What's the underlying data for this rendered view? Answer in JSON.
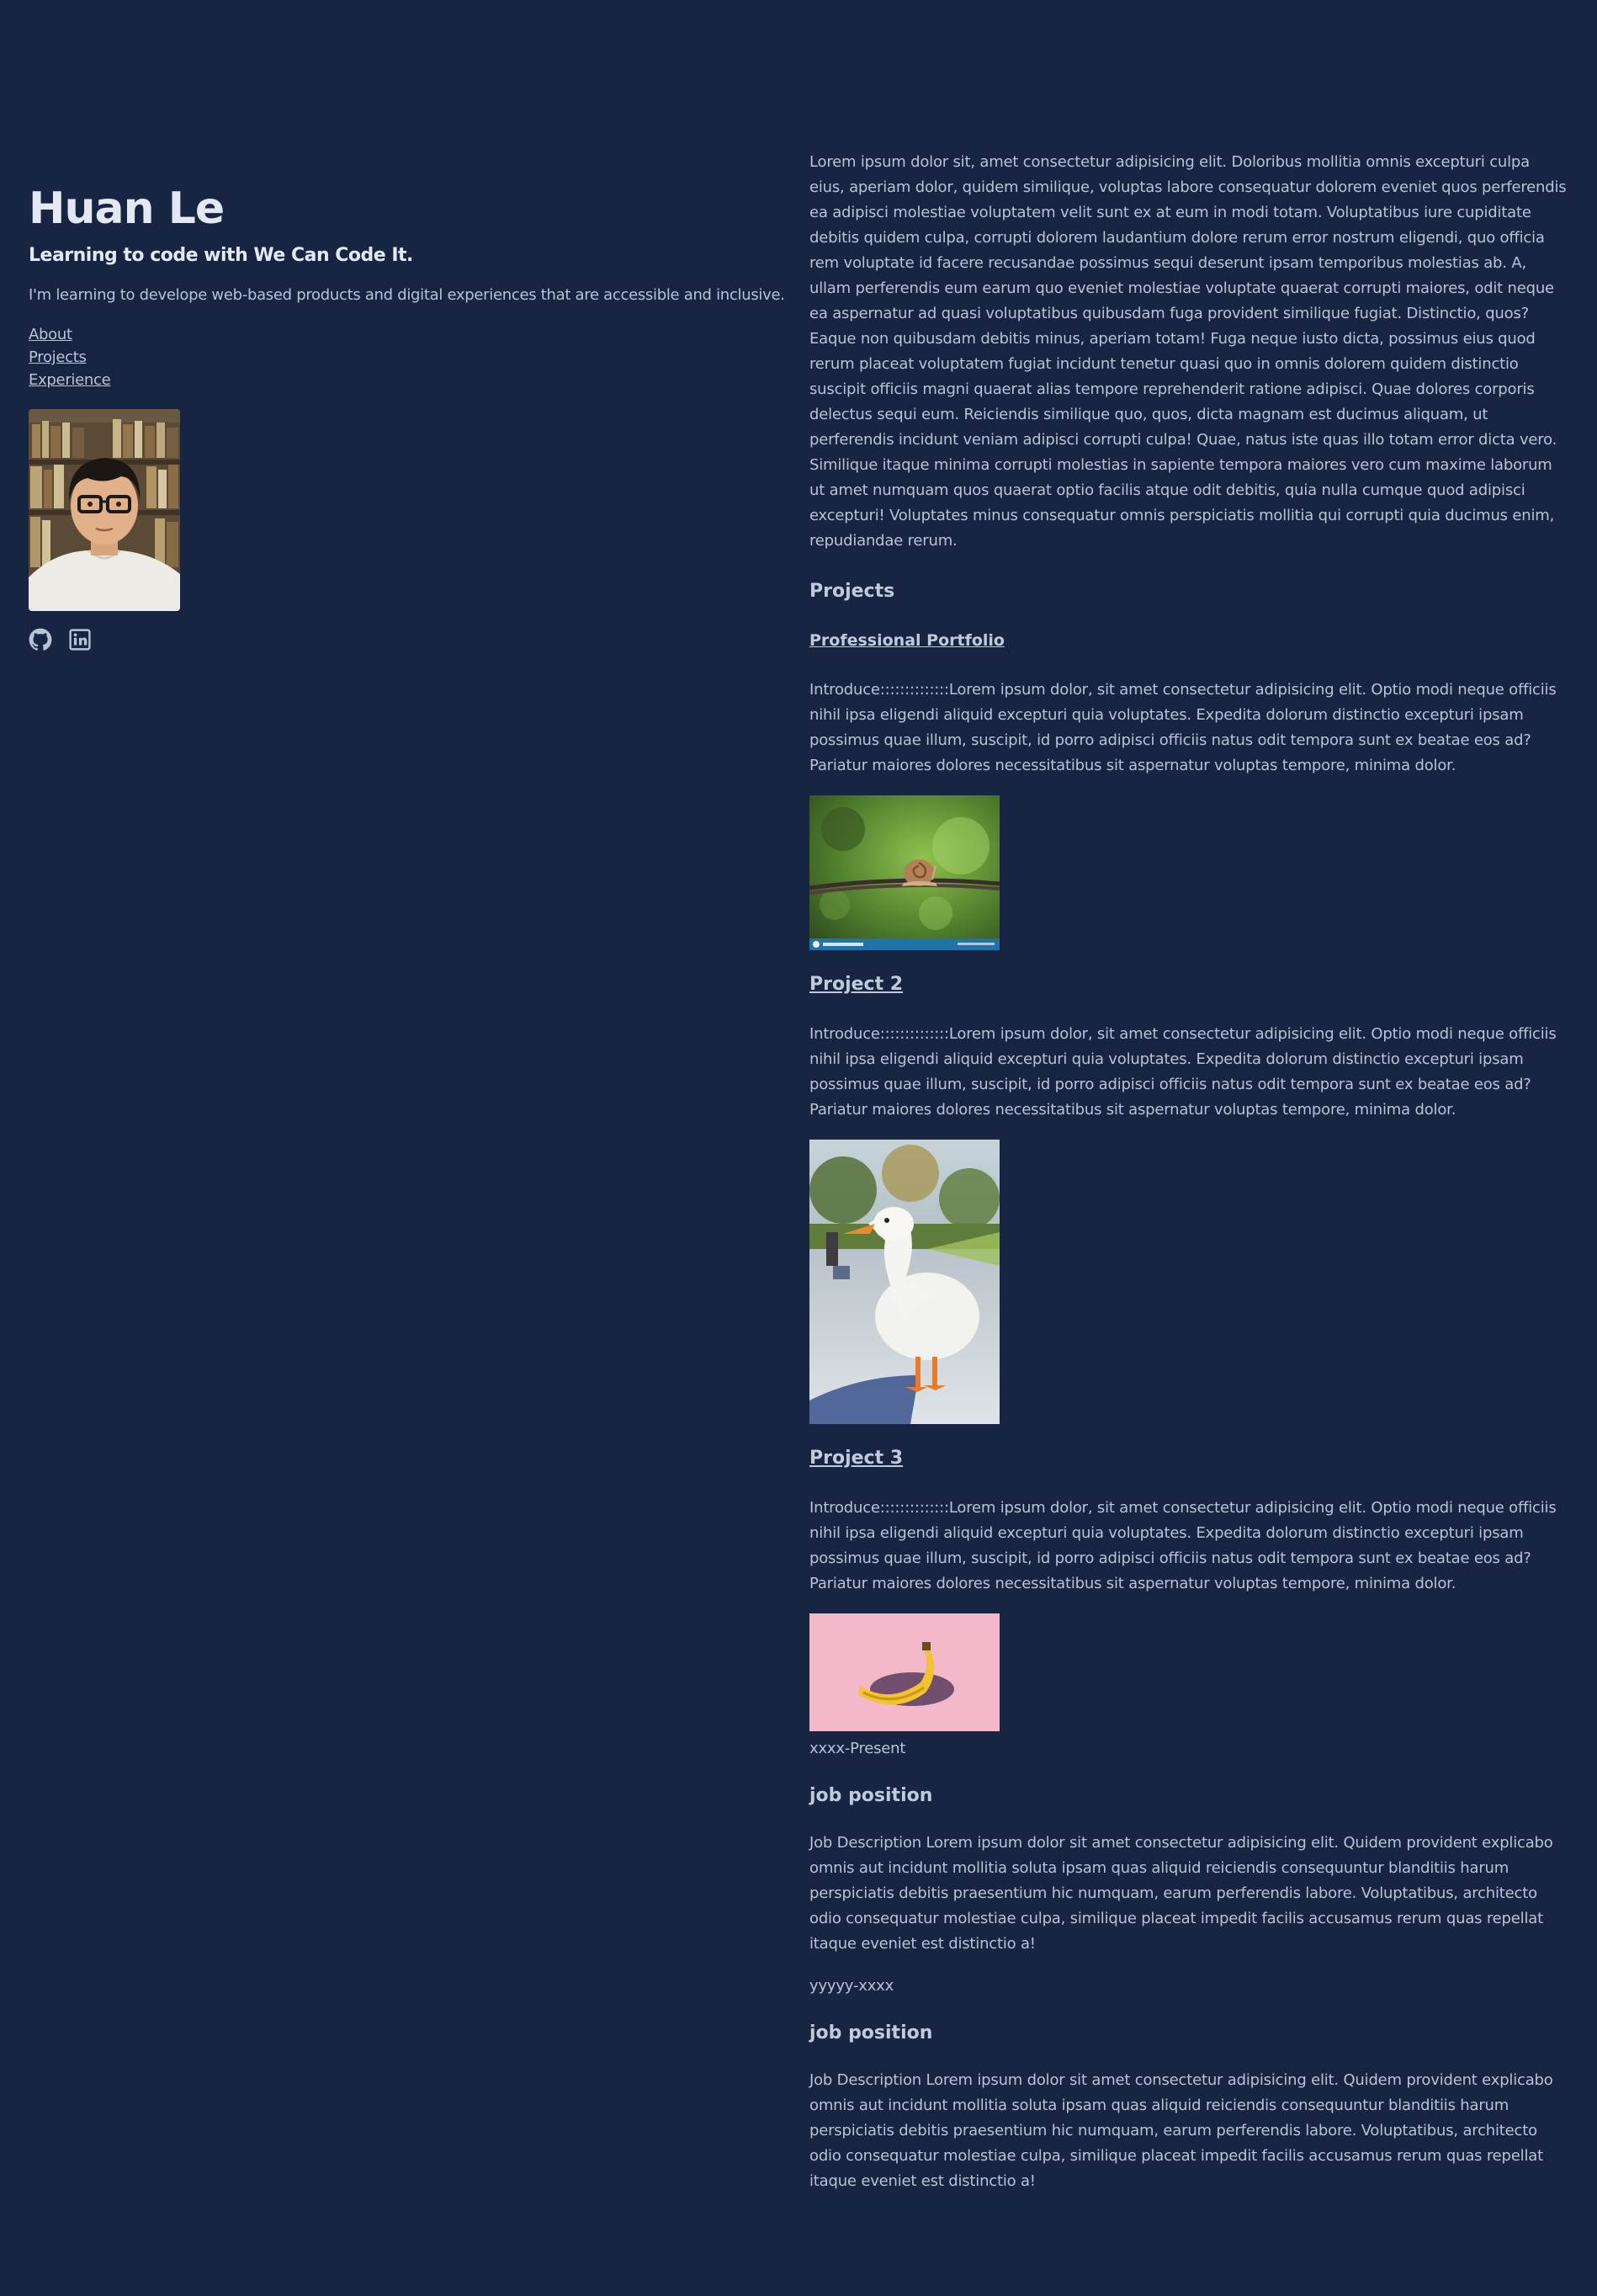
{
  "header": {
    "name": "Huan Le",
    "tagline": "Learning to code with We Can Code It.",
    "intro": "I'm learning to develope web-based products and digital experiences that are accessible and inclusive."
  },
  "nav": {
    "items": [
      {
        "label": "About"
      },
      {
        "label": "Projects"
      },
      {
        "label": "Experience"
      }
    ]
  },
  "socials": [
    {
      "icon": "github-icon"
    },
    {
      "icon": "linkedin-icon"
    }
  ],
  "about": {
    "text": "Lorem ipsum dolor sit, amet consectetur adipisicing elit. Doloribus mollitia omnis excepturi culpa eius, aperiam dolor, quidem similique, voluptas labore consequatur dolorem eveniet quos perferendis ea adipisci molestiae voluptatem velit sunt ex at eum in modi totam. Voluptatibus iure cupiditate debitis quidem culpa, corrupti dolorem laudantium dolore rerum error nostrum eligendi, quo officia rem voluptate id facere recusandae possimus sequi deserunt ipsam temporibus molestias ab. A, ullam perferendis eum earum quo eveniet molestiae voluptate quaerat corrupti maiores, odit neque ea aspernatur ad quasi voluptatibus quibusdam fuga provident similique fugiat. Distinctio, quos? Eaque non quibusdam debitis minus, aperiam totam! Fuga neque iusto dicta, possimus eius quod rerum placeat voluptatem fugiat incidunt tenetur quasi quo in omnis dolorem quidem distinctio suscipit officiis magni quaerat alias tempore reprehenderit ratione adipisci. Quae dolores corporis delectus sequi eum. Reiciendis similique quo, quos, dicta magnam est ducimus aliquam, ut perferendis incidunt veniam adipisci corrupti culpa! Quae, natus iste quas illo totam error dicta vero. Similique itaque minima corrupti molestias in sapiente tempora maiores vero cum maxime laborum ut amet numquam quos quaerat optio facilis atque odit debitis, quia nulla cumque quod adipisci excepturi! Voluptates minus consequatur omnis perspiciatis mollitia qui corrupti quia ducimus enim, repudiandae rerum."
  },
  "projects": {
    "heading": "Projects",
    "items": [
      {
        "title": "Professional Portfolio",
        "description": "Introduce::::::::::::::Lorem ipsum dolor, sit amet consectetur adipisicing elit. Optio modi neque officiis nihil ipsa eligendi aliquid excepturi quia voluptates. Expedita dolorum distinctio excepturi ipsam possimus quae illum, suscipit, id porro adipisci officiis natus odit tempora sunt ex beatae eos ad? Pariatur maiores dolores necessitatibus sit aspernatur voluptas tempore, minima dolor.",
        "image": "snail-on-wire-photo"
      },
      {
        "title": "Project 2",
        "description": "Introduce::::::::::::::Lorem ipsum dolor, sit amet consectetur adipisicing elit. Optio modi neque officiis nihil ipsa eligendi aliquid excepturi quia voluptates. Expedita dolorum distinctio excepturi ipsam possimus quae illum, suscipit, id porro adipisci officiis natus odit tempora sunt ex beatae eos ad? Pariatur maiores dolores necessitatibus sit aspernatur voluptas tempore, minima dolor.",
        "image": "white-duck-photo"
      },
      {
        "title": "Project 3",
        "description": "Introduce::::::::::::::Lorem ipsum dolor, sit amet consectetur adipisicing elit. Optio modi neque officiis nihil ipsa eligendi aliquid excepturi quia voluptates. Expedita dolorum distinctio excepturi ipsam possimus quae illum, suscipit, id porro adipisci officiis natus odit tempora sunt ex beatae eos ad? Pariatur maiores dolores necessitatibus sit aspernatur voluptas tempore, minima dolor.",
        "image": "banana-photo",
        "caption": "xxxx-Present"
      }
    ]
  },
  "experience": {
    "items": [
      {
        "title": "job position",
        "description": "Job Description Lorem ipsum dolor sit amet consectetur adipisicing elit. Quidem provident explicabo omnis aut incidunt mollitia soluta ipsam quas aliquid reiciendis consequuntur blanditiis harum perspiciatis debitis praesentium hic numquam, earum perferendis labore. Voluptatibus, architecto odio consequatur molestiae culpa, similique placeat impedit facilis accusamus rerum quas repellat itaque eveniet est distinctio a!"
      },
      {
        "dates": "yyyyy-xxxx",
        "title": "job position",
        "description": "Job Description Lorem ipsum dolor sit amet consectetur adipisicing elit. Quidem provident explicabo omnis aut incidunt mollitia soluta ipsam quas aliquid reiciendis consequuntur blanditiis harum perspiciatis debitis praesentium hic numquam, earum perferendis labore. Voluptatibus, architecto odio consequatur molestiae culpa, similique placeat impedit facilis accusamus rerum quas repellat itaque eveniet est distinctio a!"
      }
    ]
  },
  "colors": {
    "background": "#172442",
    "text": "#b8c3d6",
    "heading": "#e3e9f3"
  }
}
